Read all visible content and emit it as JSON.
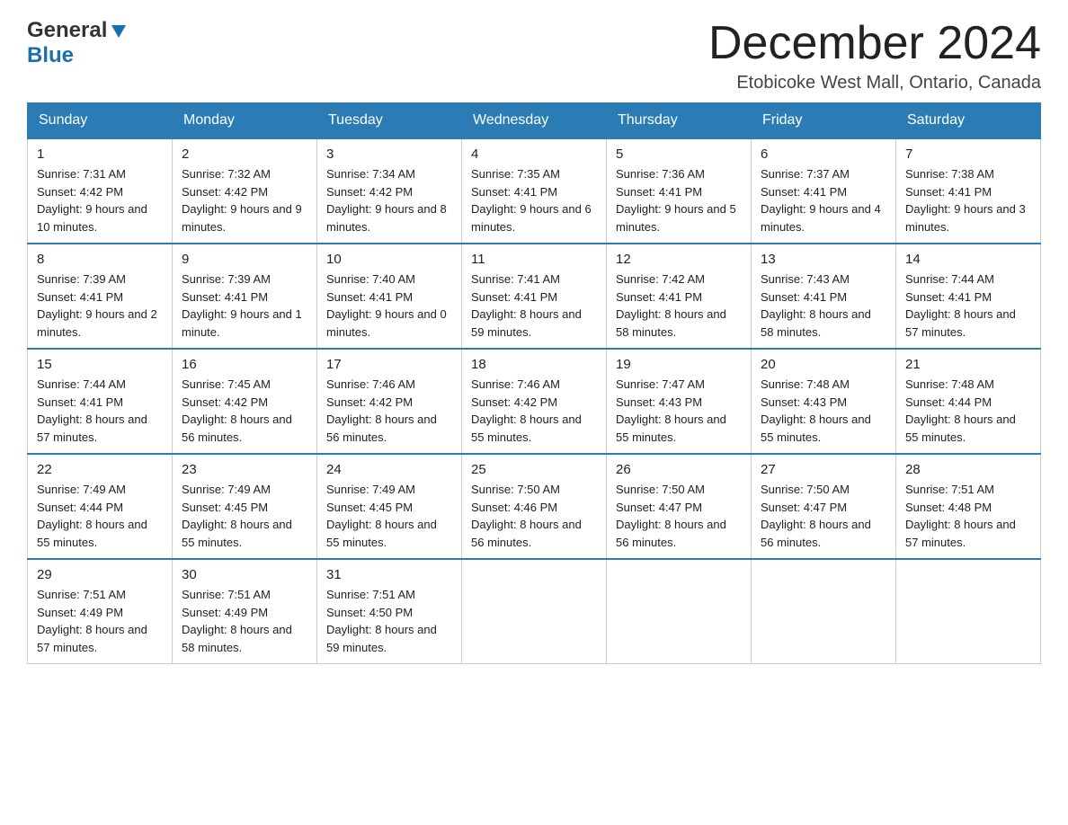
{
  "header": {
    "logo_general": "General",
    "logo_blue": "Blue",
    "month_title": "December 2024",
    "location": "Etobicoke West Mall, Ontario, Canada"
  },
  "weekdays": [
    "Sunday",
    "Monday",
    "Tuesday",
    "Wednesday",
    "Thursday",
    "Friday",
    "Saturday"
  ],
  "weeks": [
    [
      {
        "day": "1",
        "sunrise": "7:31 AM",
        "sunset": "4:42 PM",
        "daylight": "9 hours and 10 minutes."
      },
      {
        "day": "2",
        "sunrise": "7:32 AM",
        "sunset": "4:42 PM",
        "daylight": "9 hours and 9 minutes."
      },
      {
        "day": "3",
        "sunrise": "7:34 AM",
        "sunset": "4:42 PM",
        "daylight": "9 hours and 8 minutes."
      },
      {
        "day": "4",
        "sunrise": "7:35 AM",
        "sunset": "4:41 PM",
        "daylight": "9 hours and 6 minutes."
      },
      {
        "day": "5",
        "sunrise": "7:36 AM",
        "sunset": "4:41 PM",
        "daylight": "9 hours and 5 minutes."
      },
      {
        "day": "6",
        "sunrise": "7:37 AM",
        "sunset": "4:41 PM",
        "daylight": "9 hours and 4 minutes."
      },
      {
        "day": "7",
        "sunrise": "7:38 AM",
        "sunset": "4:41 PM",
        "daylight": "9 hours and 3 minutes."
      }
    ],
    [
      {
        "day": "8",
        "sunrise": "7:39 AM",
        "sunset": "4:41 PM",
        "daylight": "9 hours and 2 minutes."
      },
      {
        "day": "9",
        "sunrise": "7:39 AM",
        "sunset": "4:41 PM",
        "daylight": "9 hours and 1 minute."
      },
      {
        "day": "10",
        "sunrise": "7:40 AM",
        "sunset": "4:41 PM",
        "daylight": "9 hours and 0 minutes."
      },
      {
        "day": "11",
        "sunrise": "7:41 AM",
        "sunset": "4:41 PM",
        "daylight": "8 hours and 59 minutes."
      },
      {
        "day": "12",
        "sunrise": "7:42 AM",
        "sunset": "4:41 PM",
        "daylight": "8 hours and 58 minutes."
      },
      {
        "day": "13",
        "sunrise": "7:43 AM",
        "sunset": "4:41 PM",
        "daylight": "8 hours and 58 minutes."
      },
      {
        "day": "14",
        "sunrise": "7:44 AM",
        "sunset": "4:41 PM",
        "daylight": "8 hours and 57 minutes."
      }
    ],
    [
      {
        "day": "15",
        "sunrise": "7:44 AM",
        "sunset": "4:41 PM",
        "daylight": "8 hours and 57 minutes."
      },
      {
        "day": "16",
        "sunrise": "7:45 AM",
        "sunset": "4:42 PM",
        "daylight": "8 hours and 56 minutes."
      },
      {
        "day": "17",
        "sunrise": "7:46 AM",
        "sunset": "4:42 PM",
        "daylight": "8 hours and 56 minutes."
      },
      {
        "day": "18",
        "sunrise": "7:46 AM",
        "sunset": "4:42 PM",
        "daylight": "8 hours and 55 minutes."
      },
      {
        "day": "19",
        "sunrise": "7:47 AM",
        "sunset": "4:43 PM",
        "daylight": "8 hours and 55 minutes."
      },
      {
        "day": "20",
        "sunrise": "7:48 AM",
        "sunset": "4:43 PM",
        "daylight": "8 hours and 55 minutes."
      },
      {
        "day": "21",
        "sunrise": "7:48 AM",
        "sunset": "4:44 PM",
        "daylight": "8 hours and 55 minutes."
      }
    ],
    [
      {
        "day": "22",
        "sunrise": "7:49 AM",
        "sunset": "4:44 PM",
        "daylight": "8 hours and 55 minutes."
      },
      {
        "day": "23",
        "sunrise": "7:49 AM",
        "sunset": "4:45 PM",
        "daylight": "8 hours and 55 minutes."
      },
      {
        "day": "24",
        "sunrise": "7:49 AM",
        "sunset": "4:45 PM",
        "daylight": "8 hours and 55 minutes."
      },
      {
        "day": "25",
        "sunrise": "7:50 AM",
        "sunset": "4:46 PM",
        "daylight": "8 hours and 56 minutes."
      },
      {
        "day": "26",
        "sunrise": "7:50 AM",
        "sunset": "4:47 PM",
        "daylight": "8 hours and 56 minutes."
      },
      {
        "day": "27",
        "sunrise": "7:50 AM",
        "sunset": "4:47 PM",
        "daylight": "8 hours and 56 minutes."
      },
      {
        "day": "28",
        "sunrise": "7:51 AM",
        "sunset": "4:48 PM",
        "daylight": "8 hours and 57 minutes."
      }
    ],
    [
      {
        "day": "29",
        "sunrise": "7:51 AM",
        "sunset": "4:49 PM",
        "daylight": "8 hours and 57 minutes."
      },
      {
        "day": "30",
        "sunrise": "7:51 AM",
        "sunset": "4:49 PM",
        "daylight": "8 hours and 58 minutes."
      },
      {
        "day": "31",
        "sunrise": "7:51 AM",
        "sunset": "4:50 PM",
        "daylight": "8 hours and 59 minutes."
      },
      null,
      null,
      null,
      null
    ]
  ]
}
